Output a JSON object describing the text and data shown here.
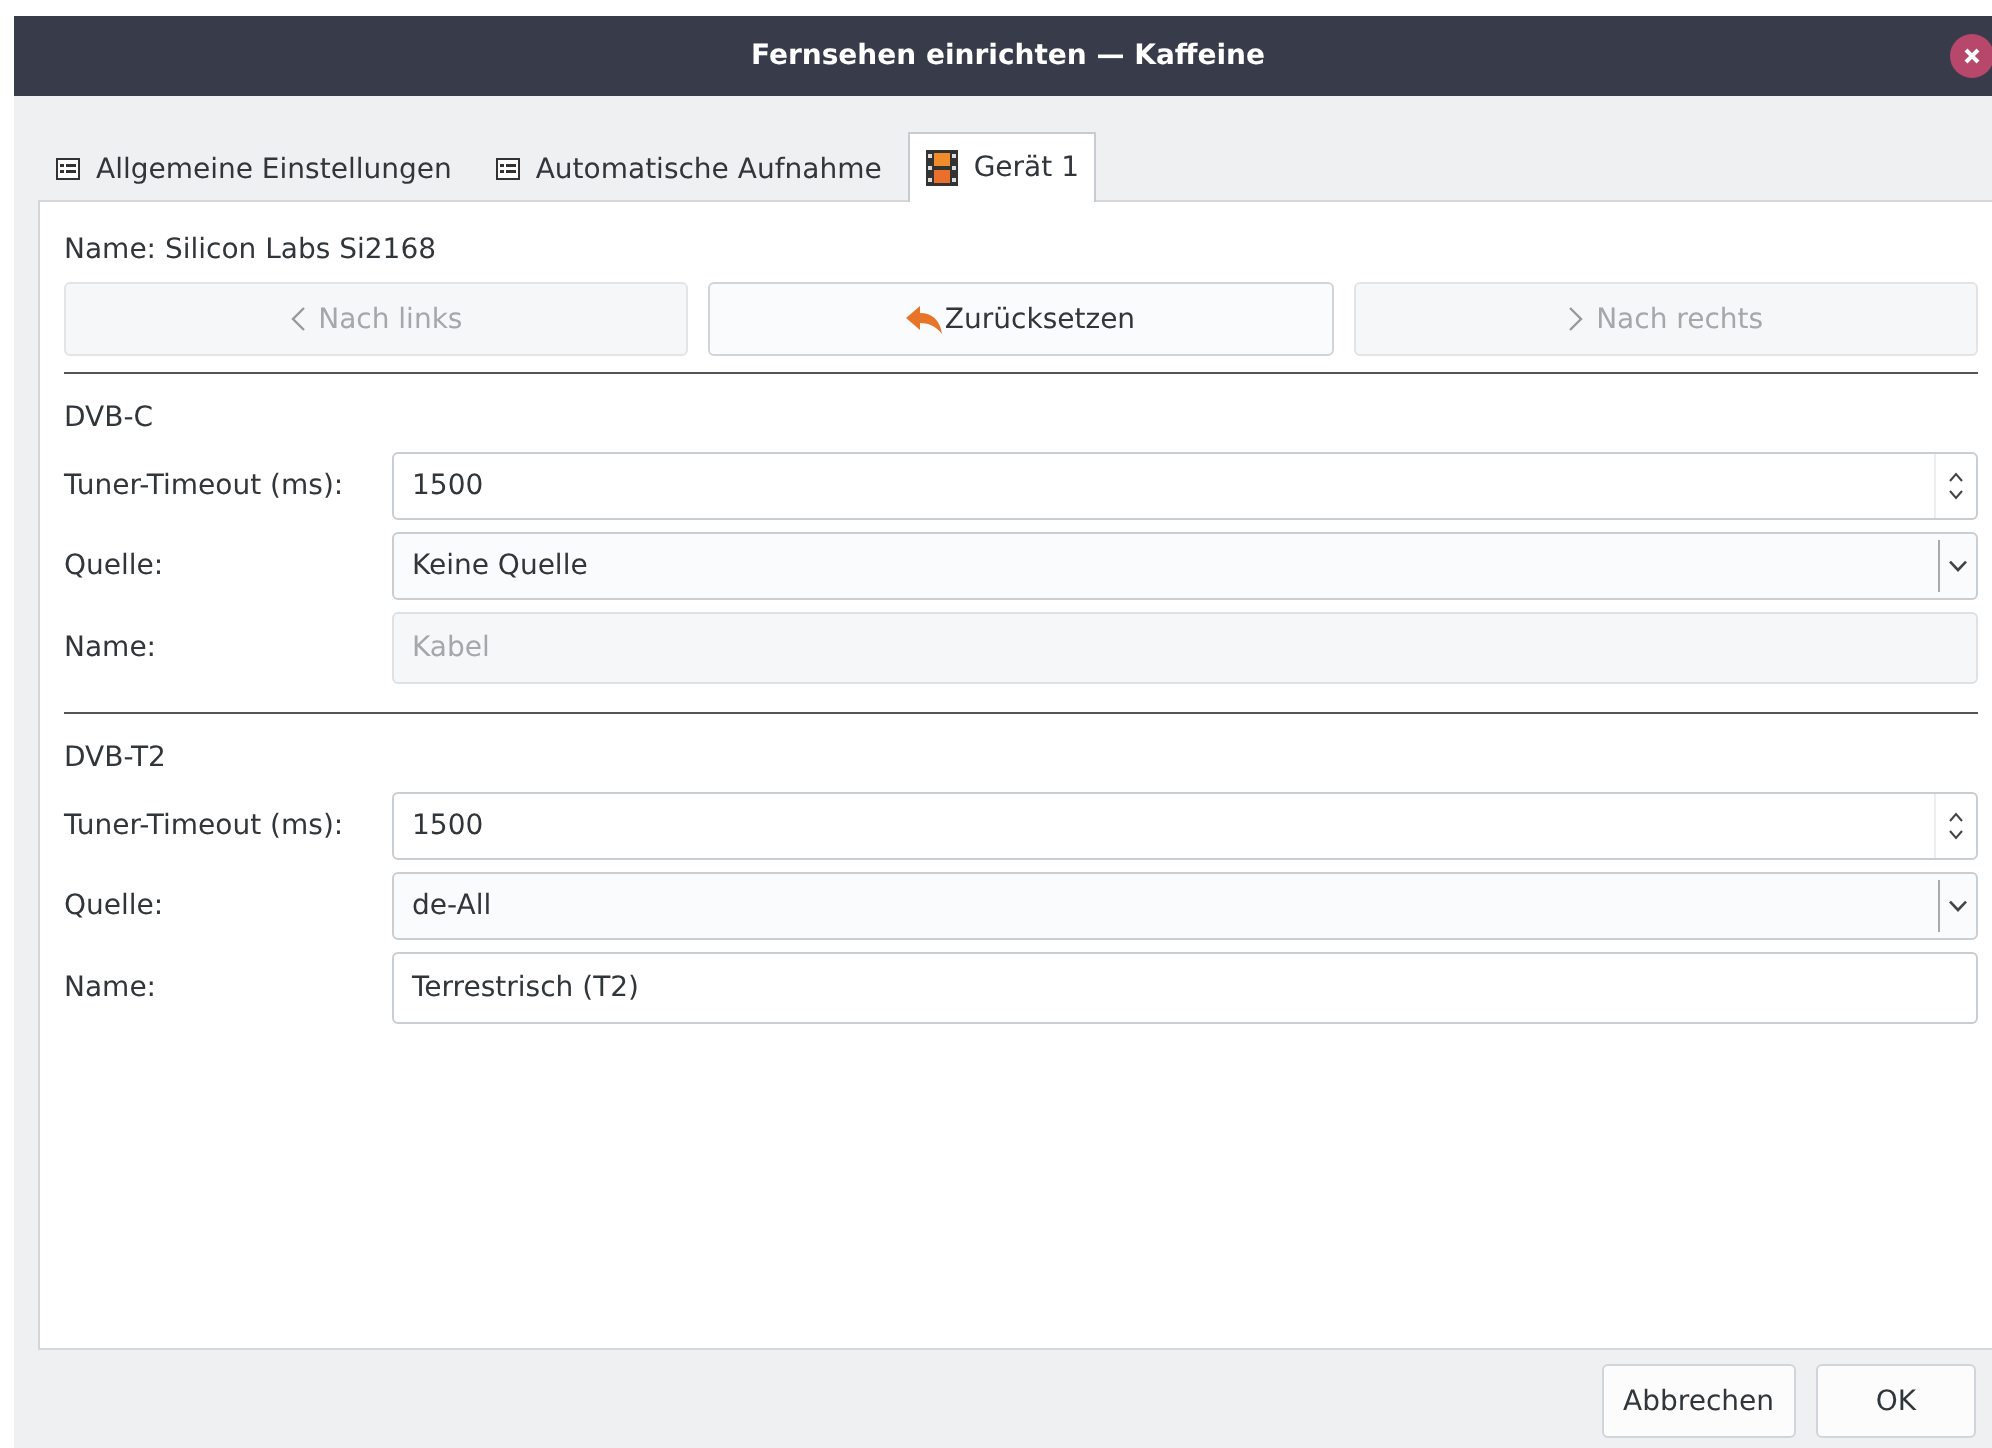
{
  "window": {
    "title": "Fernsehen einrichten — Kaffeine"
  },
  "tabs": [
    {
      "label": "Allgemeine Einstellungen",
      "kind": "list",
      "selected": false
    },
    {
      "label": "Automatische Aufnahme",
      "kind": "list",
      "selected": false
    },
    {
      "label": "Gerät 1",
      "kind": "device",
      "selected": true
    }
  ],
  "device_name": "Name: Silicon Labs Si2168",
  "nav_buttons": [
    {
      "label": "Nach links",
      "kind": "prev",
      "disabled": true
    },
    {
      "label": "Zurücksetzen",
      "kind": "reset",
      "disabled": false
    },
    {
      "label": "Nach rechts",
      "kind": "next",
      "disabled": true
    }
  ],
  "sections": [
    {
      "title": "DVB-C",
      "fields": [
        {
          "label": "Tuner-Timeout (ms):",
          "kind": "spinbox",
          "value": "1500",
          "disabled": false
        },
        {
          "label": "Quelle:",
          "kind": "combo",
          "value": "Keine Quelle",
          "disabled": false
        },
        {
          "label": "Name:",
          "kind": "text",
          "value": "Kabel",
          "disabled": true
        }
      ]
    },
    {
      "title": "DVB-T2",
      "fields": [
        {
          "label": "Tuner-Timeout (ms):",
          "kind": "spinbox",
          "value": "1500",
          "disabled": false
        },
        {
          "label": "Quelle:",
          "kind": "combo",
          "value": "de-All",
          "disabled": false
        },
        {
          "label": "Name:",
          "kind": "text",
          "value": "Terrestrisch (T2)",
          "disabled": false
        }
      ]
    }
  ],
  "buttons": [
    {
      "label": "Abbrechen"
    },
    {
      "label": "OK"
    }
  ]
}
